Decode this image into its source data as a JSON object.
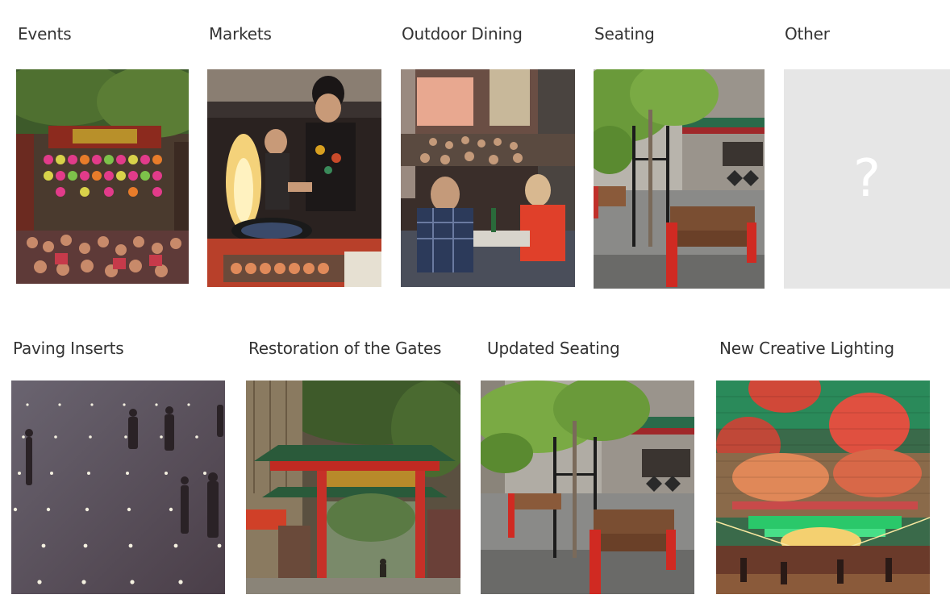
{
  "categories": {
    "events": "Events",
    "markets": "Markets",
    "outdoor_dining": "Outdoor Dining",
    "seating": "Seating",
    "other": "Other",
    "other_placeholder": "?"
  },
  "features": {
    "paving_inserts": "Paving Inserts",
    "restoration_gates": "Restoration of the Gates",
    "updated_seating": "Updated Seating",
    "creative_lighting": "New Creative Lighting"
  },
  "colors": {
    "text": "#333333",
    "placeholder_bg": "#e6e6e6",
    "placeholder_fg": "#ffffff",
    "accent_red": "#c0392b",
    "foliage_green": "#5a8a3a"
  }
}
